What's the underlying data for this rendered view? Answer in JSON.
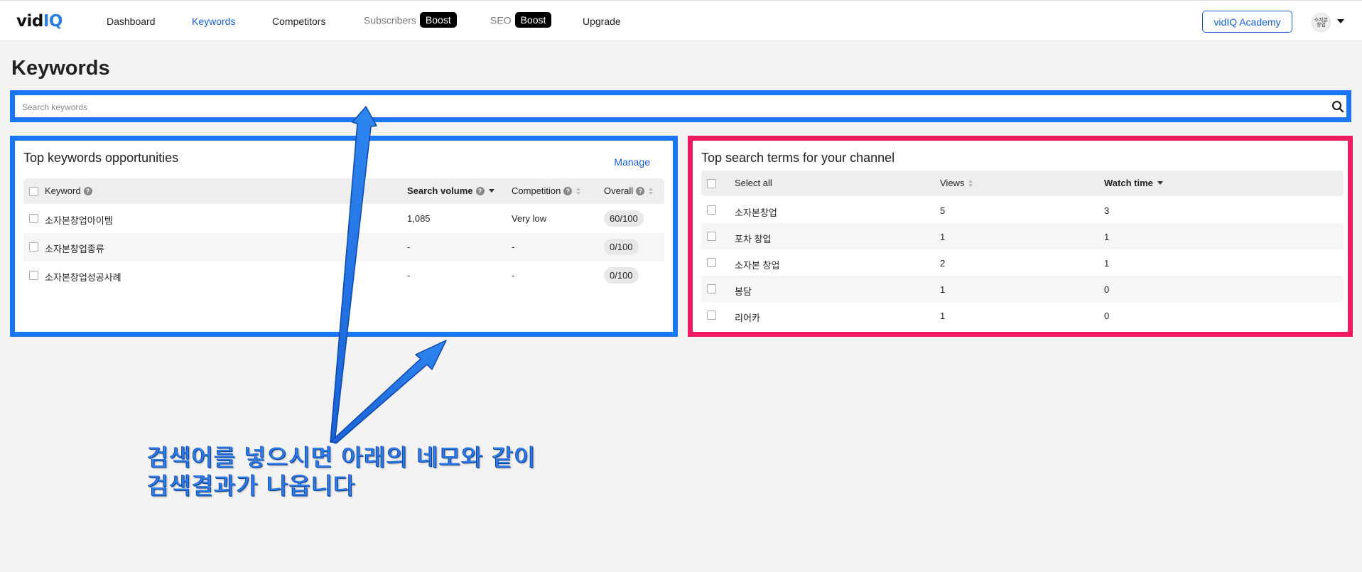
{
  "nav": {
    "logo_main": "vid",
    "logo_accent": "IQ",
    "items": [
      {
        "label": "Dashboard"
      },
      {
        "label": "Keywords"
      },
      {
        "label": "Competitors"
      },
      {
        "label": "Subscribers",
        "badge": "Boost"
      },
      {
        "label": "SEO",
        "badge": "Boost"
      },
      {
        "label": "Upgrade"
      }
    ],
    "academy_button": "vidIQ Academy",
    "avatar_text": "소자본 창업"
  },
  "page": {
    "title": "Keywords"
  },
  "search": {
    "placeholder": "Search keywords",
    "value": ""
  },
  "opportunities": {
    "title": "Top keywords opportunities",
    "manage_label": "Manage",
    "columns": [
      "Keyword",
      "Search volume",
      "Competition",
      "Overall"
    ],
    "rows": [
      {
        "keyword": "소자본창업아이템",
        "volume": "1,085",
        "competition": "Very low",
        "overall": "60/100"
      },
      {
        "keyword": "소자본창업종류",
        "volume": "-",
        "competition": "-",
        "overall": "0/100"
      },
      {
        "keyword": "소자본창업성공사례",
        "volume": "-",
        "competition": "-",
        "overall": "0/100"
      }
    ]
  },
  "search_terms": {
    "title": "Top search terms for your channel",
    "columns": [
      "Select all",
      "Views",
      "Watch time"
    ],
    "rows": [
      {
        "term": "소자본창업",
        "views": "5",
        "watch": "3"
      },
      {
        "term": "포차 창업",
        "views": "1",
        "watch": "1"
      },
      {
        "term": "소자본 창업",
        "views": "2",
        "watch": "1"
      },
      {
        "term": "봉담",
        "views": "1",
        "watch": "0"
      },
      {
        "term": "리어카",
        "views": "1",
        "watch": "0"
      }
    ]
  },
  "annotation": {
    "line1": "검색어를 넣으시면 아래의 네모와 같이",
    "line2": "검색결과가 나옵니다",
    "color": "#2f7de8"
  },
  "colors": {
    "accent_blue": "#1a76f2",
    "accent_pink": "#ee1b5f",
    "link": "#1a5fd0"
  }
}
